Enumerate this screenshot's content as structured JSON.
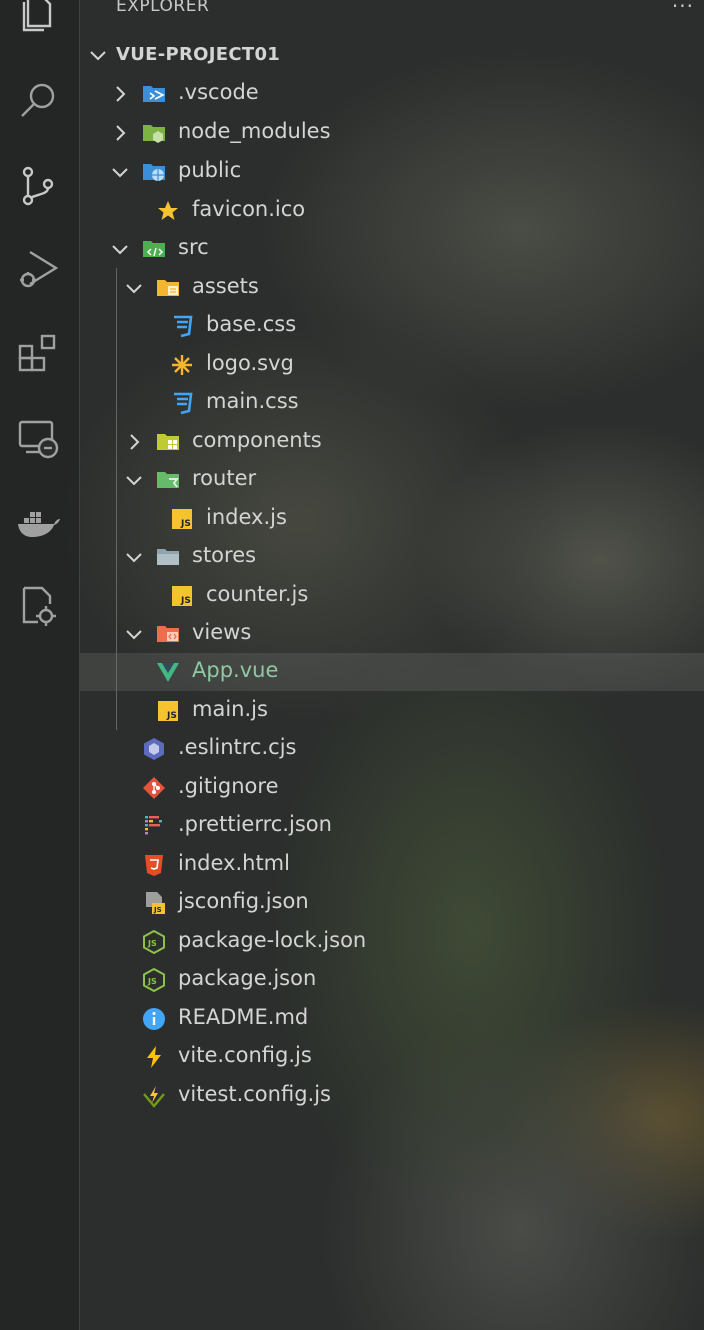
{
  "explorer": {
    "title": "EXPLORER",
    "more": "···"
  },
  "activity_bar": {
    "icons": [
      "files-icon",
      "search-icon",
      "source-control-icon",
      "run-debug-icon",
      "extensions-icon",
      "remote-explorer-icon",
      "docker-icon",
      "settings-file-icon"
    ]
  },
  "tree": {
    "root": "VUE-PROJECT01",
    "items": [
      {
        "label": ".vscode",
        "icon": "vscode-folder-icon"
      },
      {
        "label": "node_modules",
        "icon": "node-folder-icon"
      },
      {
        "label": "public",
        "icon": "public-folder-icon"
      },
      {
        "label": "favicon.ico",
        "icon": "star-icon"
      },
      {
        "label": "src",
        "icon": "src-folder-icon"
      },
      {
        "label": "assets",
        "icon": "assets-folder-icon"
      },
      {
        "label": "base.css",
        "icon": "css-icon"
      },
      {
        "label": "logo.svg",
        "icon": "svg-icon"
      },
      {
        "label": "main.css",
        "icon": "css-icon"
      },
      {
        "label": "components",
        "icon": "components-folder-icon"
      },
      {
        "label": "router",
        "icon": "router-folder-icon"
      },
      {
        "label": "index.js",
        "icon": "js-icon"
      },
      {
        "label": "stores",
        "icon": "folder-icon"
      },
      {
        "label": "counter.js",
        "icon": "js-icon"
      },
      {
        "label": "views",
        "icon": "views-folder-icon"
      },
      {
        "label": "App.vue",
        "icon": "vue-icon",
        "selected": true
      },
      {
        "label": "main.js",
        "icon": "js-icon"
      },
      {
        "label": ".eslintrc.cjs",
        "icon": "eslint-icon"
      },
      {
        "label": ".gitignore",
        "icon": "git-icon"
      },
      {
        "label": ".prettierrc.json",
        "icon": "prettier-icon"
      },
      {
        "label": "index.html",
        "icon": "html-icon"
      },
      {
        "label": "jsconfig.json",
        "icon": "jsconfig-icon"
      },
      {
        "label": "package-lock.json",
        "icon": "nodejs-icon"
      },
      {
        "label": "package.json",
        "icon": "nodejs-icon"
      },
      {
        "label": "README.md",
        "icon": "info-icon"
      },
      {
        "label": "vite.config.js",
        "icon": "vite-icon"
      },
      {
        "label": "vitest.config.js",
        "icon": "vitest-icon"
      }
    ]
  },
  "colors": {
    "text": "#d4d4d4",
    "vue_green": "#8fc9a3",
    "selection": "#5a5a5a",
    "css_blue": "#42a5f5",
    "js_yellow": "#f5c330",
    "git_orange": "#e2553a"
  }
}
